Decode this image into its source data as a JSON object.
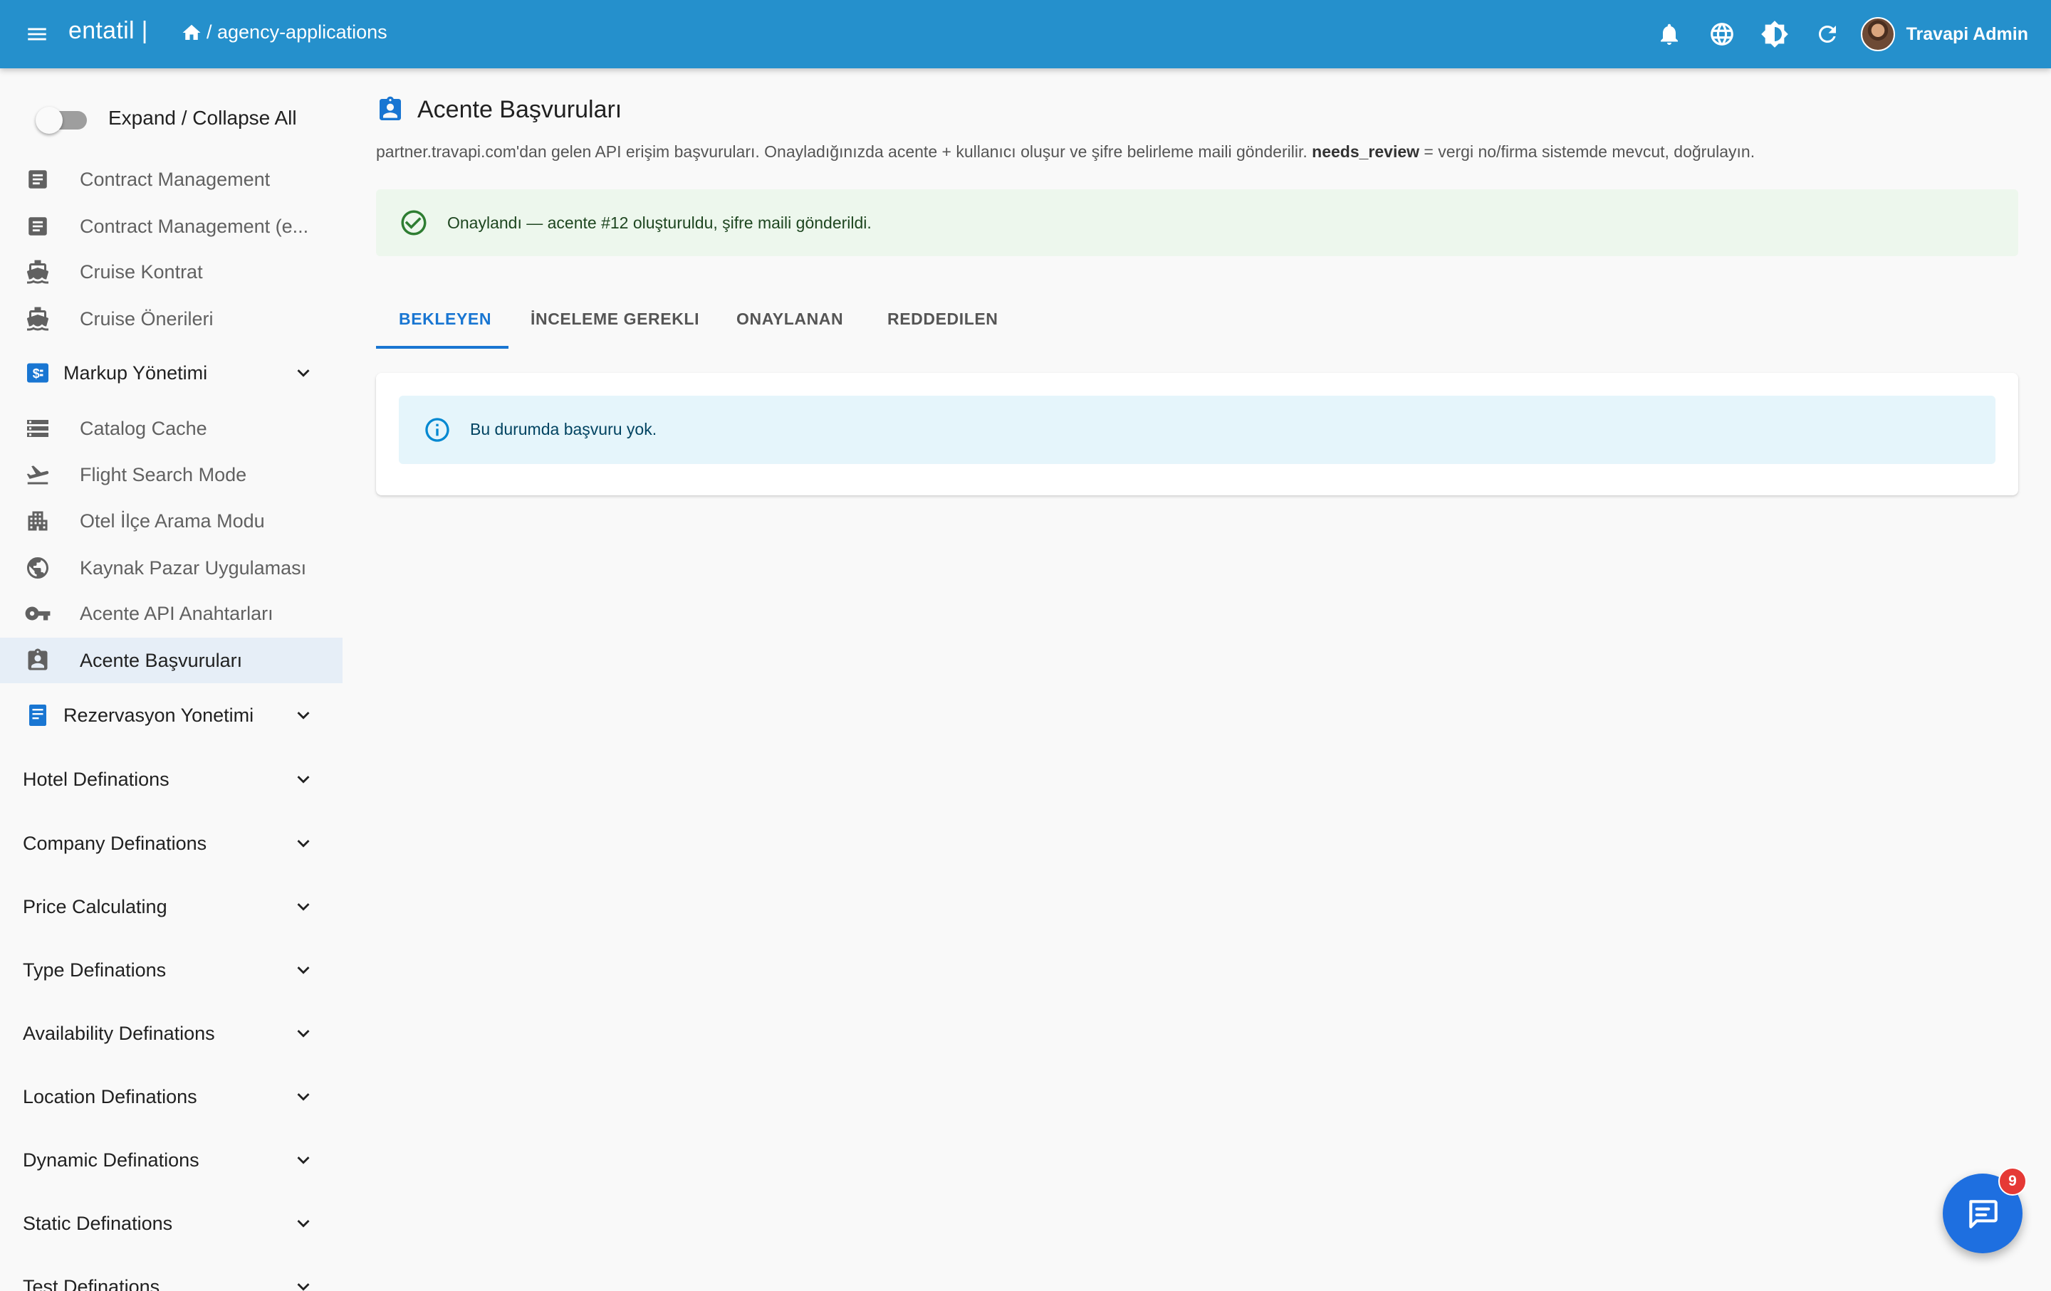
{
  "topbar": {
    "brand": "entatil |",
    "breadcrumb": "/ agency-applications",
    "user_name": "Travapi Admin",
    "color": "#2590cc",
    "icons": [
      "menu-icon",
      "home-icon",
      "bell-icon",
      "globe-icon",
      "brightness-icon",
      "refresh-icon"
    ]
  },
  "sidebar": {
    "toggle_label": "Expand / Collapse All",
    "items": [
      {
        "label": "Contract Management",
        "icon": "contract-icon"
      },
      {
        "label": "Contract Management (e...",
        "icon": "contract-icon"
      },
      {
        "label": "Cruise Kontrat",
        "icon": "ship-icon"
      },
      {
        "label": "Cruise Önerileri",
        "icon": "ship-icon"
      }
    ],
    "markup_group": {
      "label": "Markup Yönetimi",
      "icon": "price-tag-icon"
    },
    "markup_items": [
      {
        "label": "Catalog Cache",
        "icon": "storage-icon"
      },
      {
        "label": "Flight Search Mode",
        "icon": "flight-takeoff-icon"
      },
      {
        "label": "Otel İlçe Arama Modu",
        "icon": "building-icon"
      },
      {
        "label": "Kaynak Pazar Uygulaması",
        "icon": "globe-icon"
      },
      {
        "label": "Acente API Anahtarları",
        "icon": "key-icon"
      },
      {
        "label": "Acente Başvuruları",
        "icon": "badge-icon",
        "active": true
      }
    ],
    "reservation_group": {
      "label": "Rezervasyon Yonetimi",
      "icon": "receipt-icon"
    },
    "groups": [
      "Hotel Definations",
      "Company Definations",
      "Price Calculating",
      "Type Definations",
      "Availability Definations",
      "Location Definations",
      "Dynamic Definations",
      "Static Definations",
      "Test Definations"
    ]
  },
  "main": {
    "title": "Acente Başvuruları",
    "description_prefix": "partner.travapi.com'dan gelen API erişim başvuruları. Onayladığınızda acente + kullanıcı oluşur ve şifre belirleme maili gönderilir.",
    "description_bold": "needs_review",
    "description_suffix": "= vergi no/firma sistemde mevcut, doğrulayın.",
    "success_message": "Onaylandı — acente #12 oluşturuldu, şifre maili gönderildi.",
    "tabs": [
      {
        "label": "BEKLEYEN",
        "active": true
      },
      {
        "label": "İNCELEME GEREKLI"
      },
      {
        "label": "ONAYLANAN"
      },
      {
        "label": "REDDEDILEN"
      }
    ],
    "empty_message": "Bu durumda başvuru yok."
  },
  "chat": {
    "badge_count": "9",
    "color": "#1e6fe0"
  }
}
